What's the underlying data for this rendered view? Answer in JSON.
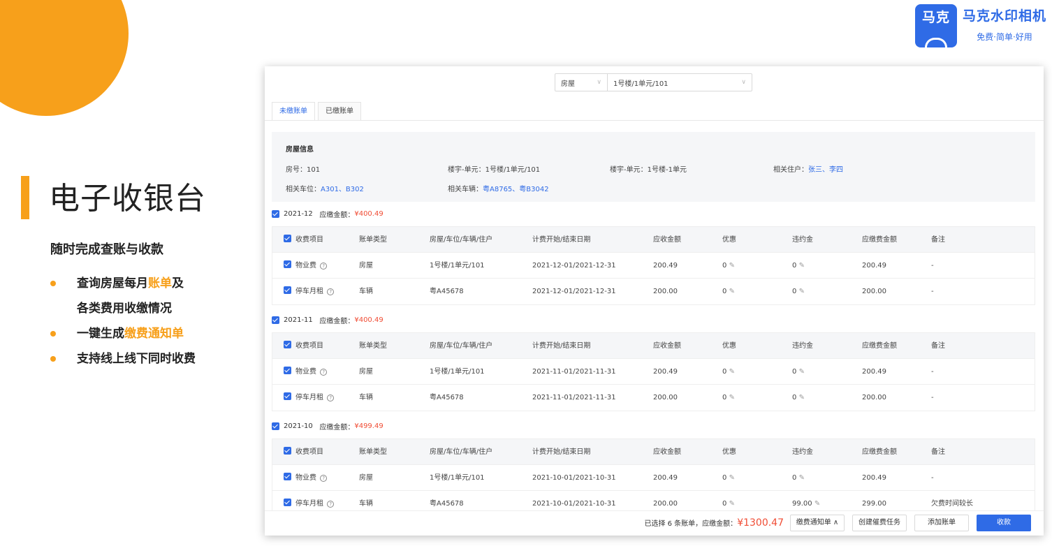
{
  "brand": {
    "mark": "马克",
    "name": "马克水印相机",
    "slogan": "免费·简单·好用"
  },
  "slide": {
    "title": "电子收银台",
    "subtitle": "随时完成查账与收款",
    "bullets": [
      {
        "pre": "查询房屋每月",
        "hl": "账单",
        "post": "及",
        "cont": "各类费用收缴情况"
      },
      {
        "pre": "一键生成",
        "hl": "缴费通知单",
        "post": "",
        "cont": ""
      },
      {
        "pre": "支持线上线下同时收费",
        "hl": "",
        "post": "",
        "cont": ""
      }
    ]
  },
  "app": {
    "select_type": "房屋",
    "select_house": "1号楼/1单元/101",
    "tabs": [
      "未缴账单",
      "已缴账单"
    ],
    "house_info": {
      "title": "房屋信息",
      "room_label": "房号：",
      "room": "101",
      "building_label": "楼宇-单元：",
      "building": "1号楼/1单元/101",
      "building2_label": "楼宇-单元：",
      "building2": "1号楼-1单元",
      "residents_label": "相关住户：",
      "residents": "张三、李四",
      "parking_label": "相关车位：",
      "parking": "A301、B302",
      "vehicles_label": "相关车辆：",
      "vehicles": "粤A8765、粤B3042"
    },
    "columns": [
      "收费项目",
      "账单类型",
      "房屋/车位/车辆/住户",
      "计费开始/结束日期",
      "应收金额",
      "优惠",
      "违约金",
      "应缴费金额",
      "备注"
    ],
    "groups": [
      {
        "month": "2021-12",
        "due_label": "应缴金额：",
        "due": "¥400.49",
        "rows": [
          {
            "item": "物业费",
            "type": "房屋",
            "target": "1号楼/1单元/101",
            "period": "2021-12-01/2021-12-31",
            "receivable": "200.49",
            "discount": "0",
            "penalty": "0",
            "payable": "200.49",
            "note": "-"
          },
          {
            "item": "停车月租",
            "type": "车辆",
            "target": "粤A45678",
            "period": "2021-12-01/2021-12-31",
            "receivable": "200.00",
            "discount": "0",
            "penalty": "0",
            "payable": "200.00",
            "note": "-"
          }
        ]
      },
      {
        "month": "2021-11",
        "due_label": "应缴金额：",
        "due": "¥400.49",
        "rows": [
          {
            "item": "物业费",
            "type": "房屋",
            "target": "1号楼/1单元/101",
            "period": "2021-11-01/2021-11-31",
            "receivable": "200.49",
            "discount": "0",
            "penalty": "0",
            "payable": "200.49",
            "note": "-"
          },
          {
            "item": "停车月租",
            "type": "车辆",
            "target": "粤A45678",
            "period": "2021-11-01/2021-11-31",
            "receivable": "200.00",
            "discount": "0",
            "penalty": "0",
            "payable": "200.00",
            "note": "-"
          }
        ]
      },
      {
        "month": "2021-10",
        "due_label": "应缴金额：",
        "due": "¥499.49",
        "rows": [
          {
            "item": "物业费",
            "type": "房屋",
            "target": "1号楼/1单元/101",
            "period": "2021-10-01/2021-10-31",
            "receivable": "200.49",
            "discount": "0",
            "penalty": "0",
            "payable": "200.49",
            "note": "-"
          },
          {
            "item": "停车月租",
            "type": "车辆",
            "target": "粤A45678",
            "period": "2021-10-01/2021-10-31",
            "receivable": "200.00",
            "discount": "0",
            "penalty": "99.00",
            "payable": "299.00",
            "note": "欠费时间较长"
          }
        ]
      }
    ],
    "footer": {
      "selected_text": "已选择 6 条账单，应缴金额：",
      "total": "¥1300.47",
      "btn_notice": "缴费通知单 ∧",
      "btn_task": "创建催费任务",
      "btn_add": "添加账单",
      "btn_collect": "收款"
    },
    "colors": {
      "primary": "#2f6be6",
      "accent": "#f7a01b",
      "amount": "#f04d35"
    }
  }
}
